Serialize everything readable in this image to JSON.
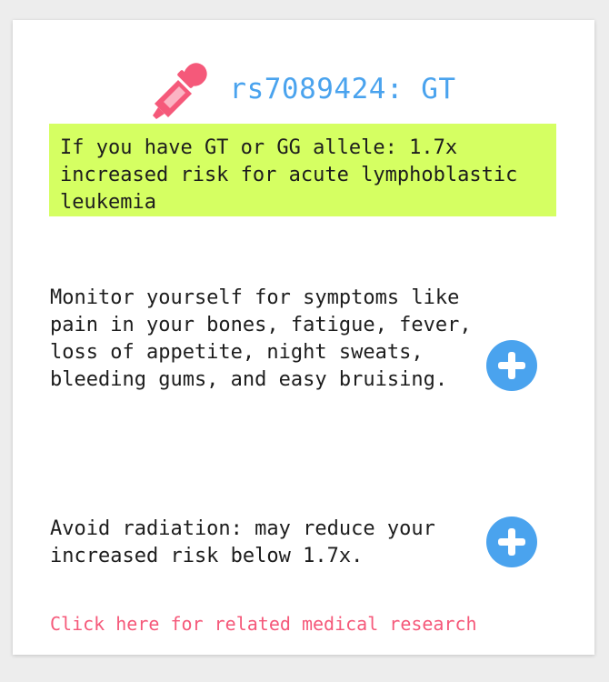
{
  "snp": {
    "title": "rs7089424: GT",
    "icon": "dropper-icon"
  },
  "risk": {
    "text": "If you have GT or GG allele: 1.7x increased risk for acute lymphoblastic leukemia"
  },
  "actions": [
    {
      "text": "Monitor yourself for symptoms like pain in your bones, fatigue, fever, loss of appetite, night sweats, bleeding gums, and easy bruising.",
      "icon": "plus-circle-icon"
    },
    {
      "text": "Avoid radiation: may reduce your increased risk below 1.7x.",
      "icon": "plus-circle-icon"
    }
  ],
  "research_link": {
    "label": "Click here for related medical research"
  },
  "colors": {
    "title": "#4aa3ee",
    "icon": "#f5597a",
    "highlight": "#d5ff62",
    "plus_button": "#4aa3ee",
    "link": "#f5597a"
  }
}
